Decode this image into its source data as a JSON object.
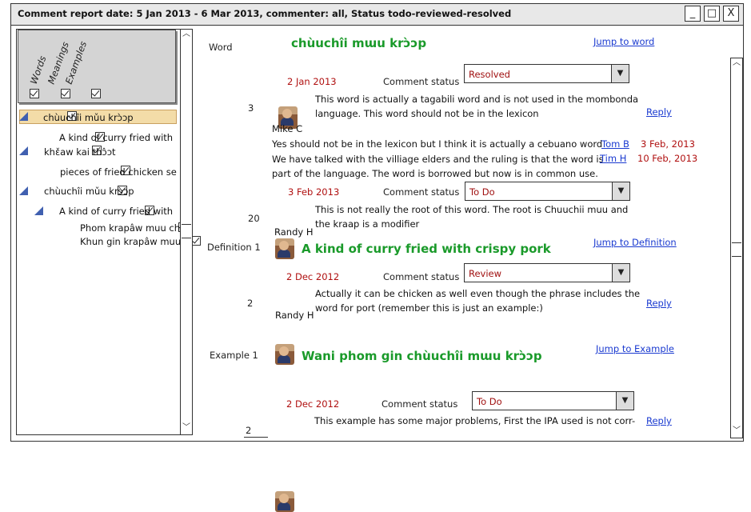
{
  "window": {
    "title": "Comment report date: 5 Jan 2013 - 6 Mar 2013, commenter: all, Status todo-reviewed-resolved",
    "minimize": "_",
    "maximize": "□",
    "close": "X"
  },
  "sidebar": {
    "columns": [
      "Words",
      "Meanings",
      "Examples"
    ],
    "tree": [
      {
        "label": "chùuchîi mǔu krɔ̀ɔp"
      },
      {
        "label": "A kind of curry fried with"
      },
      {
        "label": "khɛ̌aw kai thɔ̂ɔt"
      },
      {
        "label": "pieces of fried chicken se"
      },
      {
        "label": "chùuchîi mǔu krɔ̀ɔp"
      },
      {
        "label": "A kind of curry fried with"
      },
      {
        "label": "Phom krapâw muu ch"
      },
      {
        "label": "Khun gin krapâw muu"
      }
    ]
  },
  "report": {
    "word": {
      "label": "Word",
      "text": "chùuchîi mɯu krɔ̀ɔp",
      "jump": "Jump to word"
    },
    "status_label": "Comment status",
    "reply": "Reply",
    "c1": {
      "date": "2 Jan 2013",
      "status": "Resolved",
      "count": "3",
      "text1": "This word is actually a tagabili word and is not used in the mombonda",
      "text2": "language. This word should not be in the lexicon",
      "author": "Mike C"
    },
    "r1": {
      "text": "Yes should not be in the lexicon but I think it is actually a cebuano word",
      "author": "Tom B",
      "date": "3 Feb, 2013"
    },
    "r2": {
      "text1": "We have talked with the villiage elders and the ruling is that the word is",
      "text2": "part of the language. The word is borrowed but now is in common use.",
      "author": "Tim H",
      "date": "10 Feb, 2013"
    },
    "c2": {
      "date": "3 Feb 2013",
      "status": "To Do",
      "count": "20",
      "text1": "This is not really the root of this word. The root is Chuuchii muu and",
      "text2": "the kraap is a modifier",
      "author": "Randy H"
    },
    "def": {
      "label": "Definition 1",
      "text": "A kind of curry fried with crispy pork",
      "jump": "Jump to Definition"
    },
    "c3": {
      "date": "2 Dec 2012",
      "status": "Review",
      "count": "2",
      "text1": "Actually it can be chicken as well even though the phrase includes the",
      "text2": "word for port (remember this is just an example:)",
      "author": "Randy H"
    },
    "ex": {
      "label": "Example 1",
      "text": "Wani phom gin chùuchîi mɯu krɔ̀ɔp",
      "jump": "Jump to Example"
    },
    "c4": {
      "date": "2 Dec 2012",
      "status": "To Do",
      "count": "2",
      "text1": "This example has some major problems, First the IPA used is not corr-"
    }
  }
}
